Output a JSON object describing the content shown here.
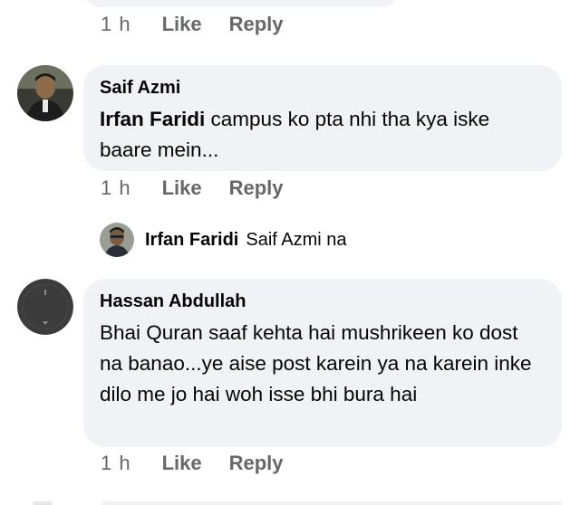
{
  "comments": [
    {
      "meta": {
        "time": "1 h",
        "like": "Like",
        "reply": "Reply"
      }
    },
    {
      "author": "Saif Azmi",
      "tag": "Irfan Faridi",
      "text": " campus ko pta nhi tha kya iske baare mein...",
      "meta": {
        "time": "1 h",
        "like": "Like",
        "reply": "Reply"
      }
    },
    {
      "author": "Hassan Abdullah",
      "text": "Bhai Quran saaf kehta hai mushrikeen ko dost na banao...ye aise post karein ya na karein inke dilo me jo hai woh isse bhi bura hai",
      "meta": {
        "time": "1 h",
        "like": "Like",
        "reply": "Reply"
      }
    }
  ],
  "collapsed_reply": {
    "name": "Irfan Faridi",
    "snippet": "Saif Azmi na"
  }
}
